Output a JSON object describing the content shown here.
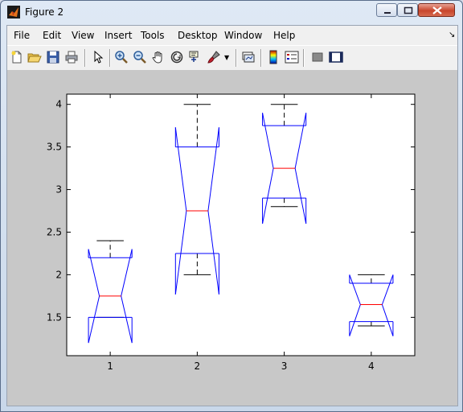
{
  "window": {
    "title": "Figure 2",
    "icon": "matlab-logo-icon"
  },
  "menubar": {
    "items": [
      "File",
      "Edit",
      "View",
      "Insert",
      "Tools",
      "Desktop",
      "Window",
      "Help"
    ]
  },
  "toolbar": {
    "buttons": [
      "new-figure-icon",
      "open-file-icon",
      "save-icon",
      "print-icon",
      "select-arrow-icon",
      "zoom-in-icon",
      "zoom-out-icon",
      "pan-hand-icon",
      "rotate-3d-icon",
      "data-cursor-icon",
      "brush-icon",
      "brush-dropdown-icon",
      "link-plot-icon",
      "colorbar-icon",
      "legend-icon",
      "hide-plot-tools-icon",
      "show-plot-tools-icon"
    ]
  },
  "chart_data": {
    "type": "boxplot",
    "notched": true,
    "categories": [
      "1",
      "2",
      "3",
      "4"
    ],
    "x_ticks": [
      "1",
      "2",
      "3",
      "4"
    ],
    "y_ticks": [
      "1.5",
      "2",
      "2.5",
      "3",
      "3.5",
      "4"
    ],
    "ylim": [
      1.05,
      4.12
    ],
    "xlim": [
      0.5,
      4.5
    ],
    "boxes": [
      {
        "category": "1",
        "min": 1.5,
        "q1": 1.5,
        "median": 1.75,
        "q3": 2.2,
        "max": 2.4,
        "notch_low": 1.2,
        "notch_high": 2.3
      },
      {
        "category": "2",
        "min": 2.0,
        "q1": 2.25,
        "median": 2.75,
        "q3": 3.5,
        "max": 4.0,
        "notch_low": 1.77,
        "notch_high": 3.73
      },
      {
        "category": "3",
        "min": 2.8,
        "q1": 2.9,
        "median": 3.25,
        "q3": 3.75,
        "max": 4.0,
        "notch_low": 2.6,
        "notch_high": 3.9
      },
      {
        "category": "4",
        "min": 1.4,
        "q1": 1.45,
        "median": 1.65,
        "q3": 1.9,
        "max": 2.0,
        "notch_low": 1.28,
        "notch_high": 2.0
      }
    ],
    "colors": {
      "box": "#0000ff",
      "median": "#ff0000",
      "whisker": "#000000"
    },
    "grid": false
  }
}
